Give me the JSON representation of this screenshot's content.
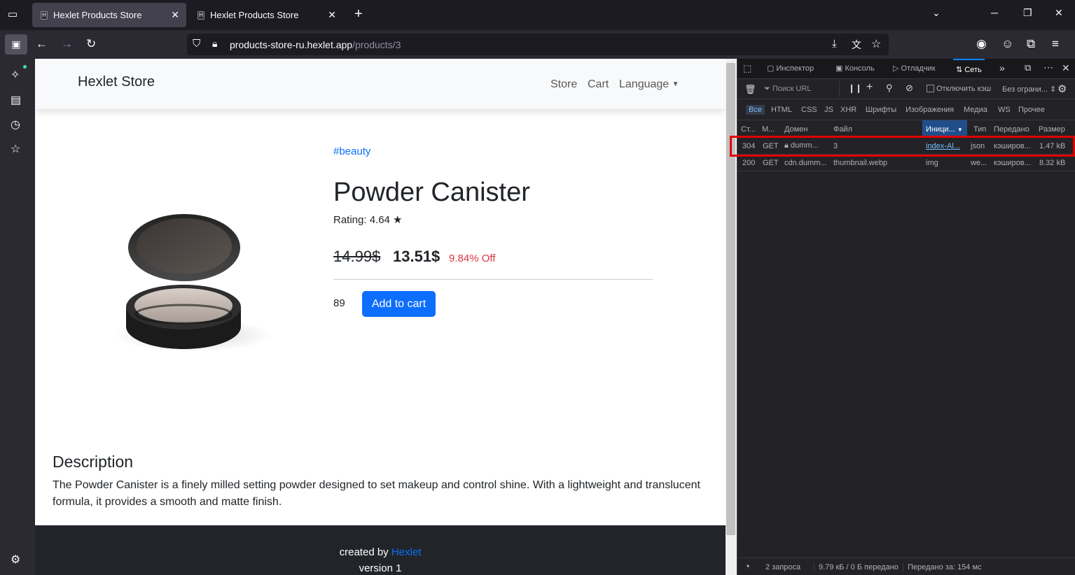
{
  "tabs": [
    {
      "title": "Hexlet Products Store",
      "active": true
    },
    {
      "title": "Hexlet Products Store",
      "active": false
    }
  ],
  "address_bar": {
    "url_host": "products-store-ru.hexlet.app",
    "url_path": "/products/3"
  },
  "site": {
    "brand": "Hexlet Store",
    "nav": {
      "store": "Store",
      "cart": "Cart",
      "language": "Language"
    }
  },
  "product": {
    "tag": "#beauty",
    "title": "Powder Canister",
    "rating": "Rating: 4.64 ★",
    "old_price": "14.99$",
    "new_price": "13.51$",
    "discount": "9.84% Off",
    "stock": "89",
    "add_to_cart": "Add to cart",
    "description_heading": "Description",
    "description": "The Powder Canister is a finely milled setting powder designed to set makeup and control shine. With a lightweight and translucent formula, it provides a smooth and matte finish."
  },
  "footer": {
    "created_by": "created by",
    "link": "Hexlet",
    "version": "version 1"
  },
  "devtools": {
    "tabs": {
      "inspector": "Инспектор",
      "console": "Консоль",
      "debugger": "Отладчик",
      "network": "Сеть"
    },
    "filter_placeholder": "Поиск URL",
    "disable_cache": "Отключить кэш",
    "throttle": "Без ограни...",
    "type_filters": [
      "Все",
      "HTML",
      "CSS",
      "JS",
      "XHR",
      "Шрифты",
      "Изображения",
      "Медиа",
      "WS",
      "Прочее"
    ],
    "columns": [
      "Ст...",
      "М...",
      "Домен",
      "Файл",
      "Иници...",
      "Тип",
      "Передано",
      "Размер"
    ],
    "rows": [
      {
        "status": "304",
        "method": "GET",
        "domain": "dumm...",
        "file": "3",
        "initiator": "index-Al...",
        "type": "json",
        "transferred": "кэширов...",
        "size": "1.47 kB"
      },
      {
        "status": "200",
        "method": "GET",
        "domain": "cdn.dumm...",
        "file": "thumbnail.webp",
        "initiator": "img",
        "type": "we...",
        "transferred": "кэширов...",
        "size": "8.32 kB"
      }
    ],
    "status_bar": {
      "requests": "2 запроса",
      "transferred": "9.79 кБ / 0 Б передано",
      "finish": "Передано за: 154 мс"
    }
  },
  "colors": {
    "accent": "#0d6efd",
    "discount": "#dc3545",
    "highlight": "#e00000"
  }
}
